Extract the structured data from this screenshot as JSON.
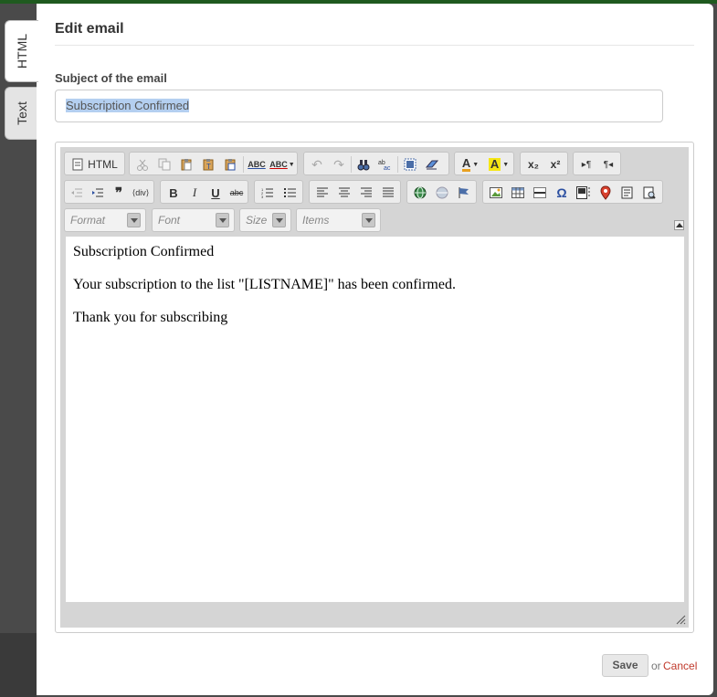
{
  "side_tabs": [
    {
      "label": "HTML",
      "active": true
    },
    {
      "label": "Text",
      "active": false
    }
  ],
  "dialog": {
    "title": "Edit email",
    "subject_label": "Subject of the email",
    "subject_value": "Subscription Confirmed"
  },
  "toolbar": {
    "source_label": "HTML",
    "spell_label": "ABC",
    "sub_label": "x₂",
    "sup_label": "x²",
    "bold_label": "B",
    "italic_label": "I",
    "underline_label": "U",
    "strike_label": "abc",
    "format_placeholder": "Format",
    "font_placeholder": "Font",
    "size_placeholder": "Size",
    "items_placeholder": "Items"
  },
  "editor_content": [
    "Subscription Confirmed",
    "Your subscription to the list \"[LISTNAME]\" has been confirmed.",
    "Thank you for subscribing"
  ],
  "footer": {
    "save_label": "Save",
    "or_text": "or",
    "cancel_label": "Cancel"
  },
  "colors": {
    "cancel_link": "#c0392b",
    "selection": "#b4cff0",
    "highlight_yellow": "#f5e615"
  }
}
